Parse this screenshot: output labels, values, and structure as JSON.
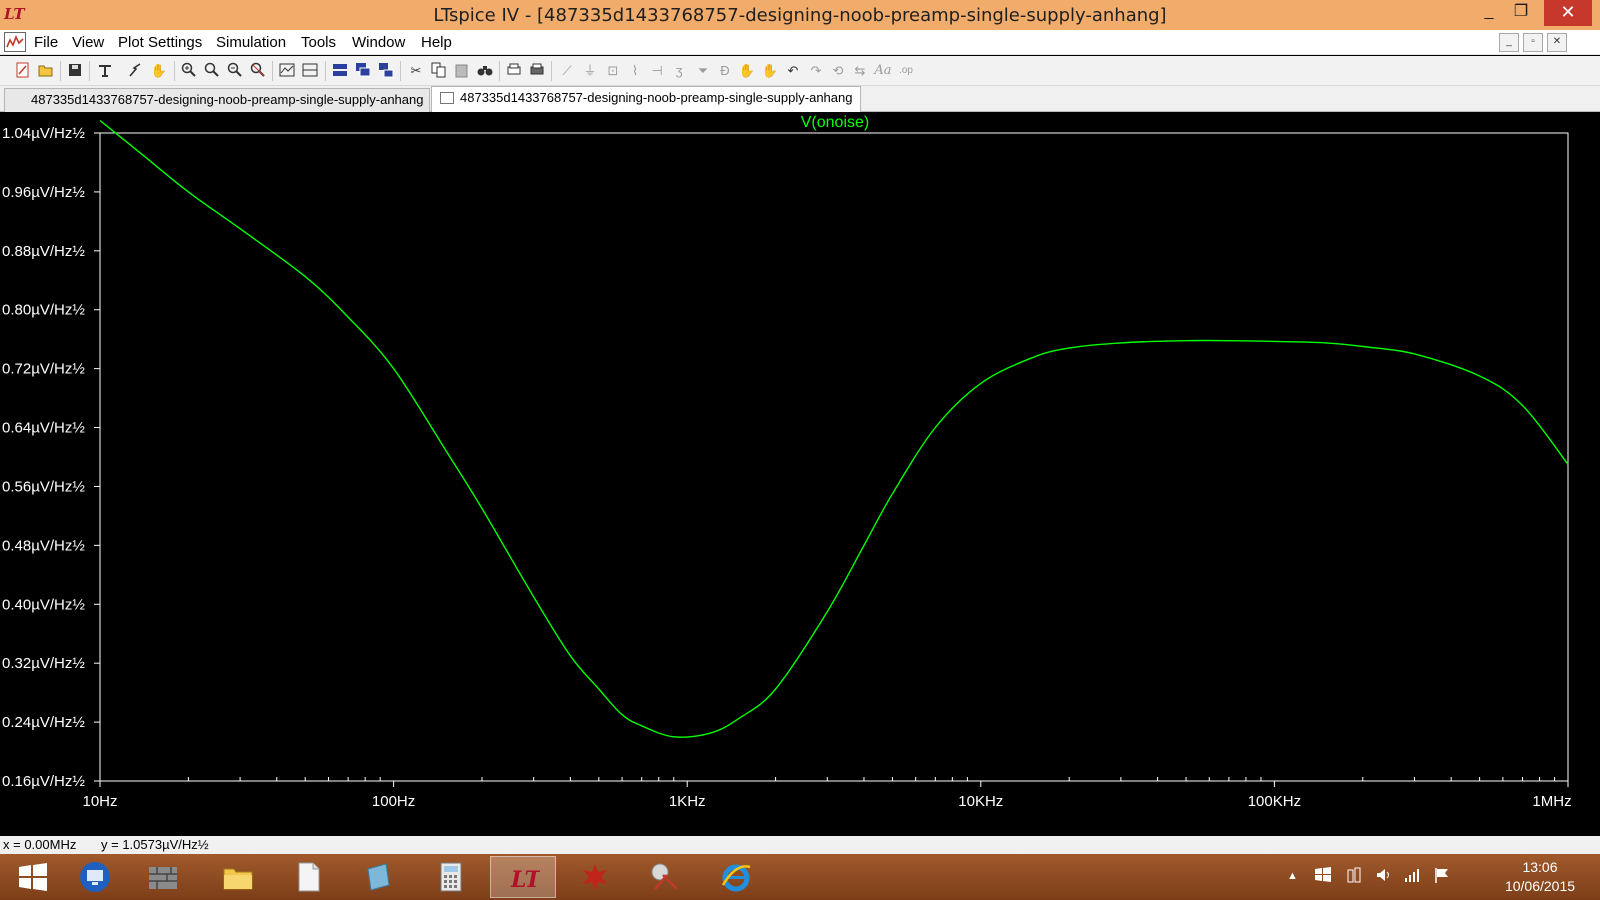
{
  "window": {
    "title": "LTspice IV - [487335d1433768757-designing-noob-preamp-single-supply-anhang]",
    "app_logo": "LT",
    "minimize_label": "_",
    "maximize_label": "❐",
    "close_label": "✕"
  },
  "menu": {
    "items": [
      {
        "label": "File"
      },
      {
        "label": "View"
      },
      {
        "label": "Plot Settings"
      },
      {
        "label": "Simulation"
      },
      {
        "label": "Tools"
      },
      {
        "label": "Window"
      },
      {
        "label": "Help"
      }
    ],
    "mdi_minimize": "_",
    "mdi_restore": "▫",
    "mdi_close": "✕"
  },
  "toolbar": {
    "icons": [
      "new-schematic-icon",
      "open-icon",
      "save-icon",
      "control-panel-icon",
      "run-icon",
      "pan-hand-icon",
      "zoom-in-icon",
      "zoom-rect-icon",
      "zoom-out-icon",
      "zoom-fit-icon",
      "autorange-icon",
      "plot-pane-icon",
      "tile-horizontal-icon",
      "cascade-icon",
      "tile-vertical-icon",
      "cut-icon",
      "copy-icon",
      "paste-icon",
      "find-icon",
      "print-preview-icon",
      "print-icon",
      "wire-icon",
      "ground-icon",
      "label-icon",
      "resistor-icon",
      "capacitor-icon",
      "inductor-icon",
      "diode-icon",
      "component-icon",
      "move-icon",
      "drag-icon",
      "undo-icon",
      "redo-icon",
      "rotate-icon",
      "mirror-icon",
      "text-icon",
      "spice-directive-icon"
    ]
  },
  "tabs": [
    {
      "label": "487335d1433768757-designing-noob-preamp-single-supply-anhang",
      "active": false
    },
    {
      "label": "487335d1433768757-designing-noob-preamp-single-supply-anhang",
      "active": true
    }
  ],
  "status": {
    "x_readout": "x = 0.00MHz",
    "y_readout": "y = 1.0573µV/Hz½"
  },
  "taskbar": {
    "apps": [
      "windows-start-icon",
      "remote-desktop-icon",
      "firewall-icon",
      "file-explorer-icon",
      "document-icon",
      "notepad-icon",
      "calculator-icon",
      "ltspice-icon",
      "paint-splash-icon",
      "snipping-tool-icon",
      "internet-explorer-icon"
    ],
    "active_index": 7,
    "time": "13:06",
    "date": "10/06/2015"
  },
  "colors": {
    "trace": "#00ff00",
    "axis": "#ffffff",
    "plot_bg": "#000000",
    "grid_tick": "#ffffff"
  },
  "chart_data": {
    "type": "line",
    "title": "",
    "xlabel": "",
    "ylabel": "",
    "x_scale": "log",
    "xlim": [
      10,
      1000000
    ],
    "ylim": [
      0.16,
      1.04
    ],
    "x_ticks": [
      {
        "value": 10,
        "label": "10Hz"
      },
      {
        "value": 100,
        "label": "100Hz"
      },
      {
        "value": 1000,
        "label": "1KHz"
      },
      {
        "value": 10000,
        "label": "10KHz"
      },
      {
        "value": 100000,
        "label": "100KHz"
      },
      {
        "value": 1000000,
        "label": "1MHz"
      }
    ],
    "y_ticks": [
      {
        "value": 1.04,
        "label": "1.04µV/Hz½"
      },
      {
        "value": 0.96,
        "label": "0.96µV/Hz½"
      },
      {
        "value": 0.88,
        "label": "0.88µV/Hz½"
      },
      {
        "value": 0.8,
        "label": "0.80µV/Hz½"
      },
      {
        "value": 0.72,
        "label": "0.72µV/Hz½"
      },
      {
        "value": 0.64,
        "label": "0.64µV/Hz½"
      },
      {
        "value": 0.56,
        "label": "0.56µV/Hz½"
      },
      {
        "value": 0.48,
        "label": "0.48µV/Hz½"
      },
      {
        "value": 0.4,
        "label": "0.40µV/Hz½"
      },
      {
        "value": 0.32,
        "label": "0.32µV/Hz½"
      },
      {
        "value": 0.24,
        "label": "0.24µV/Hz½"
      },
      {
        "value": 0.16,
        "label": "0.16µV/Hz½"
      }
    ],
    "grid": false,
    "series": [
      {
        "name": "V(onoise)",
        "x": [
          10,
          14,
          20,
          30,
          50,
          70,
          100,
          150,
          200,
          300,
          400,
          500,
          600,
          700,
          900,
          1200,
          1500,
          2000,
          3000,
          4000,
          5000,
          7000,
          10000,
          15000,
          20000,
          30000,
          50000,
          70000,
          100000,
          150000,
          200000,
          300000,
          500000,
          700000,
          1000000
        ],
        "y": [
          1.057,
          1.01,
          0.96,
          0.91,
          0.845,
          0.79,
          0.72,
          0.61,
          0.53,
          0.41,
          0.33,
          0.285,
          0.25,
          0.235,
          0.22,
          0.225,
          0.245,
          0.285,
          0.39,
          0.48,
          0.55,
          0.64,
          0.7,
          0.735,
          0.748,
          0.755,
          0.758,
          0.758,
          0.757,
          0.755,
          0.75,
          0.74,
          0.71,
          0.67,
          0.59
        ]
      }
    ]
  }
}
